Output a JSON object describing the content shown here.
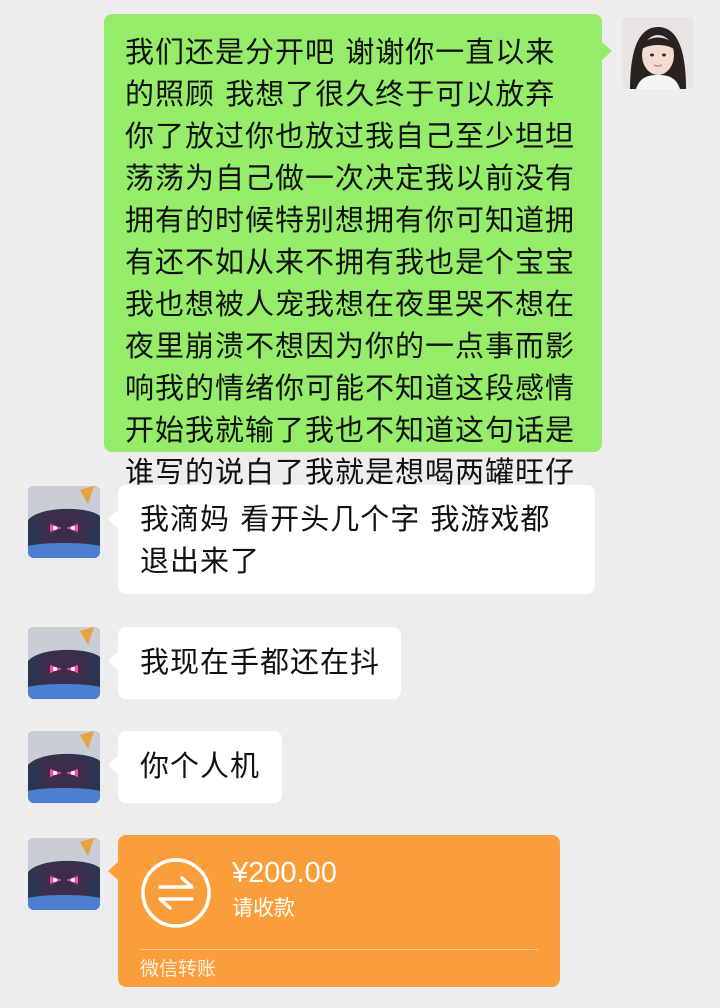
{
  "messages": [
    {
      "side": "sent",
      "text": "我们还是分开吧 谢谢你一直以来的照顾 我想了很久终于可以放弃你了放过你也放过我自己至少坦坦荡荡为自己做一次决定我以前没有拥有的时候特别想拥有你可知道拥有还不如从来不拥有我也是个宝宝我也想被人宠我想在夜里哭不想在夜里崩溃不想因为你的一点事而影响我的情绪你可能不知道这段感情开始我就输了我也不知道这句话是谁写的说白了我就是想喝两罐旺仔牛奶"
    },
    {
      "side": "received",
      "text": "我滴妈 看开头几个字 我游戏都退出来了"
    },
    {
      "side": "received",
      "text": "我现在手都还在抖"
    },
    {
      "side": "received",
      "text": "你个人机"
    }
  ],
  "transfer": {
    "amount": "¥200.00",
    "subtitle": "请收款",
    "footer": "微信转账",
    "icon": "transfer-arrows-icon",
    "color": "#fa9d3b"
  },
  "colors": {
    "background": "#ededed",
    "sent_bubble": "#95ec69",
    "received_bubble": "#ffffff"
  }
}
